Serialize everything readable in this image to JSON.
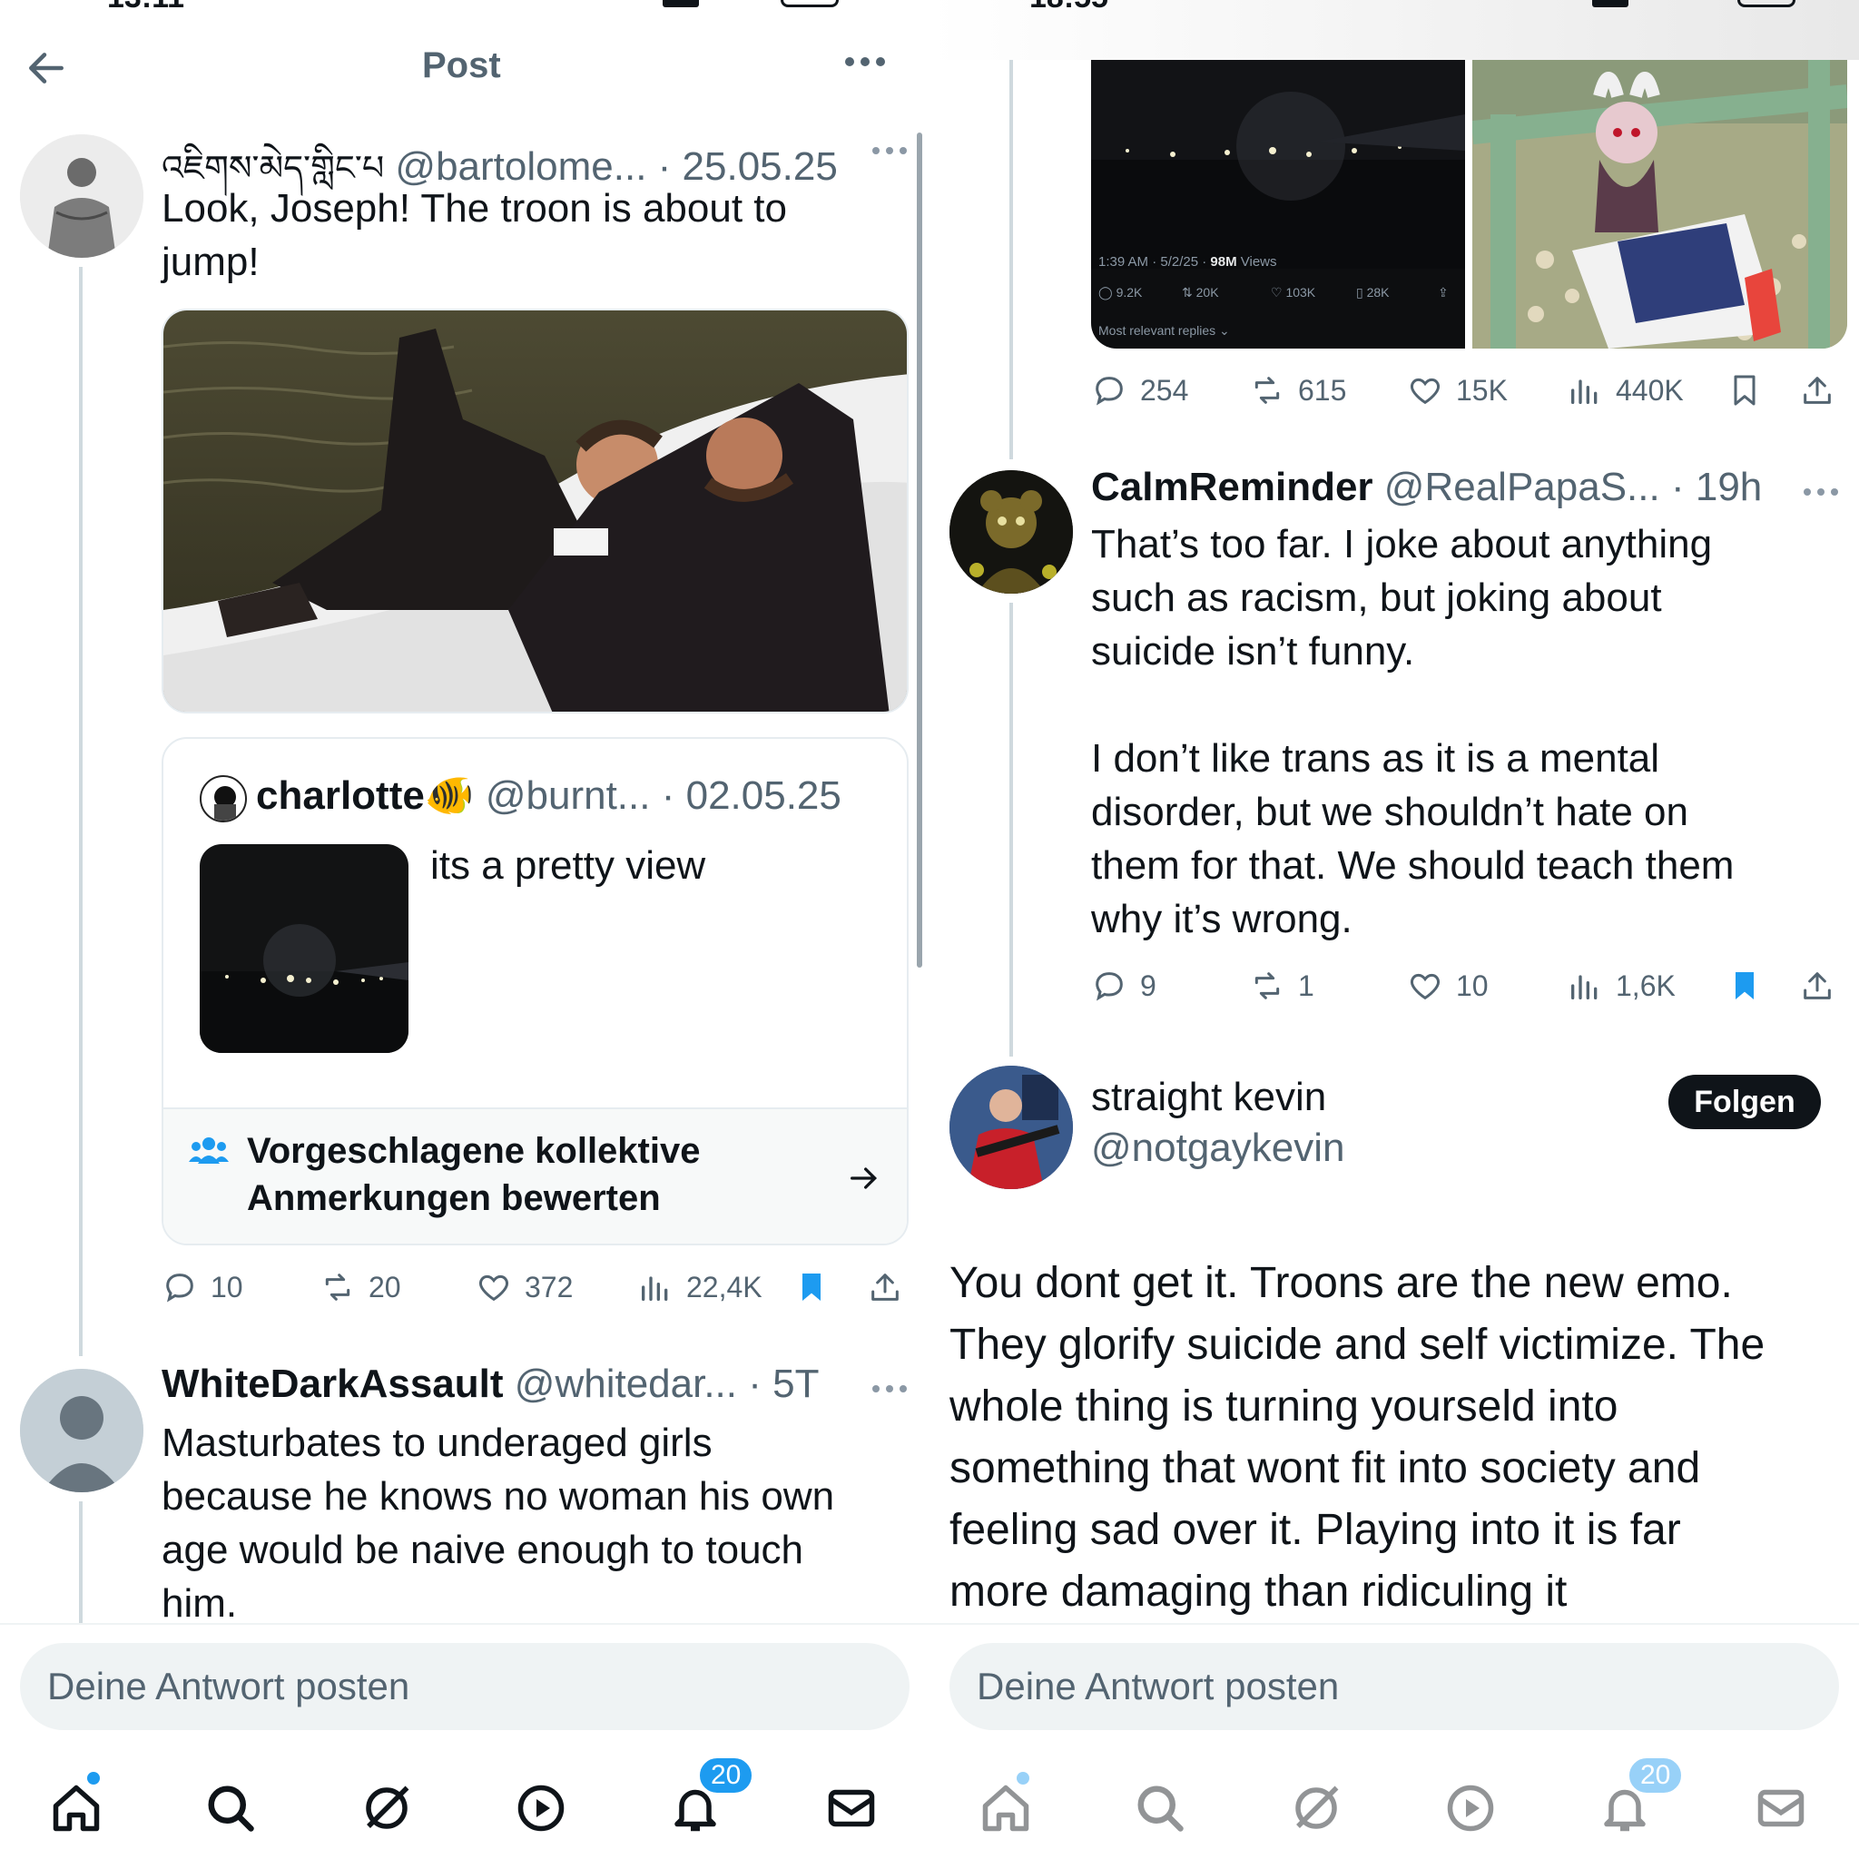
{
  "left": {
    "status_time": "13:11",
    "header": {
      "title": "Post"
    },
    "main_post": {
      "display_name": "འཇིགས་མེད་གླིང་པ",
      "handle": "@bartolome...",
      "date": "· 25.05.25",
      "text_line1": "Look, Joseph! The troon is about to",
      "text_line2": "jump!",
      "quoted": {
        "display_name": "charlotte🐠",
        "handle": "@burnt...",
        "date": "· 02.05.25",
        "text": "its a pretty view"
      },
      "community_notes": {
        "line1": "Vorgeschlagene kollektive",
        "line2": "Anmerkungen bewerten"
      },
      "stats": {
        "replies": "10",
        "reposts": "20",
        "likes": "372",
        "views": "22,4K"
      }
    },
    "reply": {
      "display_name": "WhiteDarkAssault",
      "handle": "@whitedar...",
      "date": "· 5T",
      "lines": [
        "Masturbates to underaged girls",
        "because he knows no woman his own",
        "age would be naive enough to touch",
        "him."
      ]
    },
    "reply_placeholder": "Deine Antwort posten",
    "tabbar": {
      "notifications_badge": "20"
    }
  },
  "right": {
    "status_time": "18:55",
    "embedded_screenshot": {
      "meta": "1:39 AM · 5/2/25 · ",
      "views": "98M",
      "views_label": " Views",
      "stat1": "9.2K",
      "stat2": "20K",
      "stat3": "103K",
      "stat4": "28K",
      "replies_label": "Most relevant replies ⌄"
    },
    "top_post_stats": {
      "replies": "254",
      "reposts": "615",
      "likes": "15K",
      "views": "440K"
    },
    "calm_post": {
      "display_name": "CalmReminder",
      "handle": "@RealPapaS...",
      "date": "· 19h",
      "lines": [
        "That’s too far. I joke about anything",
        "such as racism, but joking about",
        "suicide isn’t funny.",
        "",
        "I don’t like trans as it is a mental",
        "disorder, but we shouldn’t hate on",
        "them for that. We should teach them",
        "why it’s wrong."
      ],
      "stats": {
        "replies": "9",
        "reposts": "1",
        "likes": "10",
        "views": "1,6K"
      }
    },
    "kevin_post": {
      "display_name": "straight kevin",
      "handle": "@notgaykevin",
      "follow_label": "Folgen",
      "lines": [
        "You dont get it. Troons are the new emo.",
        "They glorify suicide and self victimize. The",
        "whole thing is turning yourseld into",
        "something that wont fit into society and",
        "feeling sad over it. Playing into it is far",
        "more damaging than ridiculing it"
      ]
    },
    "reply_placeholder": "Deine Antwort posten",
    "tabbar": {
      "notifications_badge": "20"
    }
  },
  "colors": {
    "accent": "#1d9bf0",
    "muted": "#536471",
    "text": "#0f1419",
    "divider": "#cfd9de"
  }
}
